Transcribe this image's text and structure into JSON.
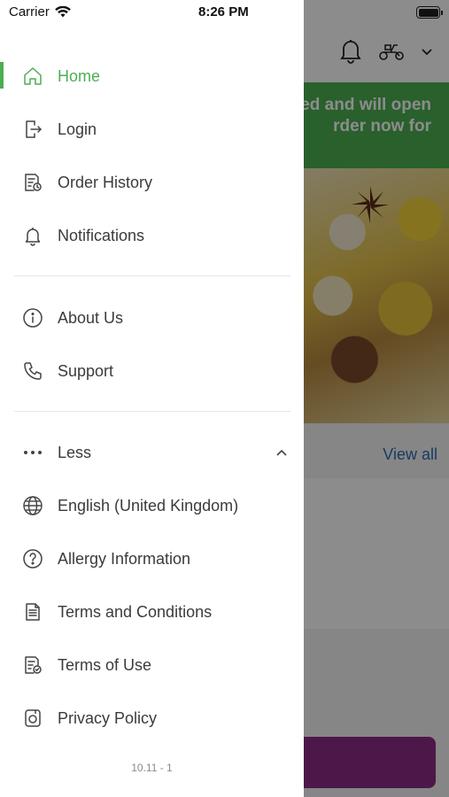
{
  "status_bar": {
    "carrier": "Carrier",
    "time": "8:26 PM"
  },
  "background": {
    "banner_text": "ed and will open\nrder now for",
    "view_all": "View all",
    "colors": {
      "banner": "#4caf50",
      "link": "#2a6db3",
      "button": "#8b2c86"
    }
  },
  "drawer": {
    "accent": "#4cae50",
    "primary_items": [
      {
        "label": "Home",
        "icon": "home-icon",
        "active": true
      },
      {
        "label": "Login",
        "icon": "login-icon"
      },
      {
        "label": "Order History",
        "icon": "order-history-icon"
      },
      {
        "label": "Notifications",
        "icon": "bell-icon"
      }
    ],
    "secondary_items": [
      {
        "label": "About Us",
        "icon": "info-icon"
      },
      {
        "label": "Support",
        "icon": "phone-icon"
      }
    ],
    "more_toggle": {
      "label": "Less",
      "icon": "more-dots-icon",
      "state": "expanded"
    },
    "extra_items": [
      {
        "label": "English (United Kingdom)",
        "icon": "globe-icon"
      },
      {
        "label": "Allergy Information",
        "icon": "question-icon"
      },
      {
        "label": "Terms and Conditions",
        "icon": "document-icon"
      },
      {
        "label": "Terms of Use",
        "icon": "document-check-icon"
      },
      {
        "label": "Privacy Policy",
        "icon": "privacy-icon"
      }
    ],
    "version": "10.11 - 1"
  }
}
